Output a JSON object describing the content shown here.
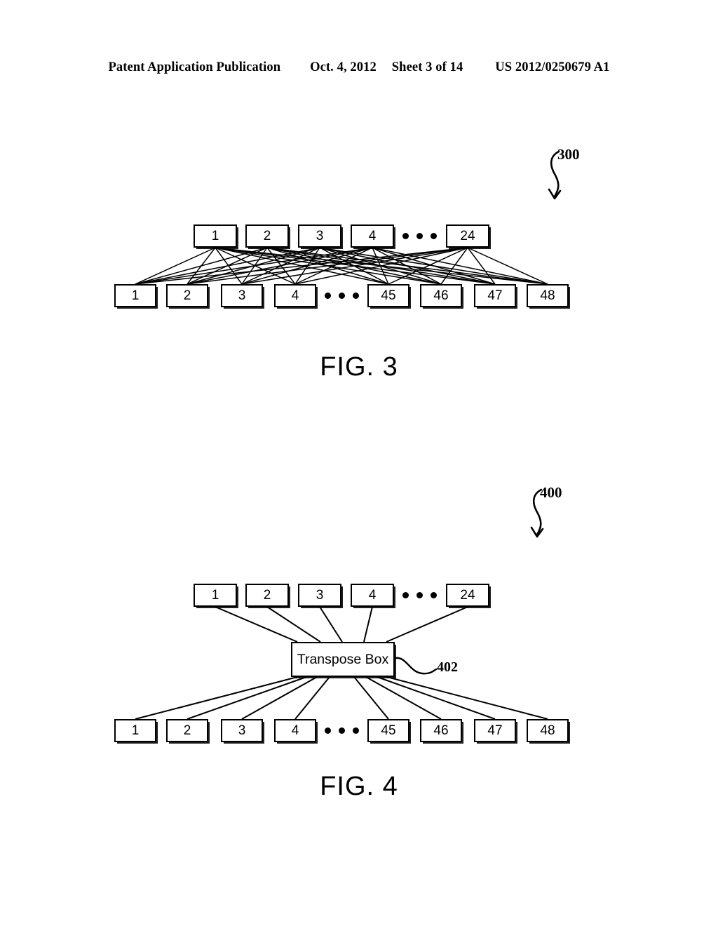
{
  "header": {
    "publication": "Patent Application Publication",
    "date": "Oct. 4, 2012",
    "sheet": "Sheet 3 of 14",
    "patent_number": "US 2012/0250679 A1"
  },
  "figures": [
    {
      "id": "fig3",
      "caption": "FIG. 3",
      "reference_number": "300",
      "description": "Full mesh interconnect between 24 top nodes and 48 bottom nodes",
      "top_row": {
        "labels": [
          "1",
          "2",
          "3",
          "4",
          "24"
        ],
        "ellipsis_after_index": 3,
        "ellipsis_dots": 3,
        "total_implied": 24
      },
      "bottom_row": {
        "labels": [
          "1",
          "2",
          "3",
          "4",
          "45",
          "46",
          "47",
          "48"
        ],
        "ellipsis_after_index": 3,
        "ellipsis_dots": 3,
        "total_implied": 48
      }
    },
    {
      "id": "fig4",
      "caption": "FIG. 4",
      "reference_number": "400",
      "description": "Transpose box interconnect between 24 top nodes and 48 bottom nodes",
      "top_row": {
        "labels": [
          "1",
          "2",
          "3",
          "4",
          "24"
        ],
        "ellipsis_after_index": 3,
        "ellipsis_dots": 3,
        "total_implied": 24
      },
      "bottom_row": {
        "labels": [
          "1",
          "2",
          "3",
          "4",
          "45",
          "46",
          "47",
          "48"
        ],
        "ellipsis_after_index": 3,
        "ellipsis_dots": 3,
        "total_implied": 48
      },
      "center_node": {
        "label": "Transpose Box",
        "reference_number": "402"
      }
    }
  ],
  "colors": {
    "ink": "#000000",
    "paper": "#ffffff"
  }
}
